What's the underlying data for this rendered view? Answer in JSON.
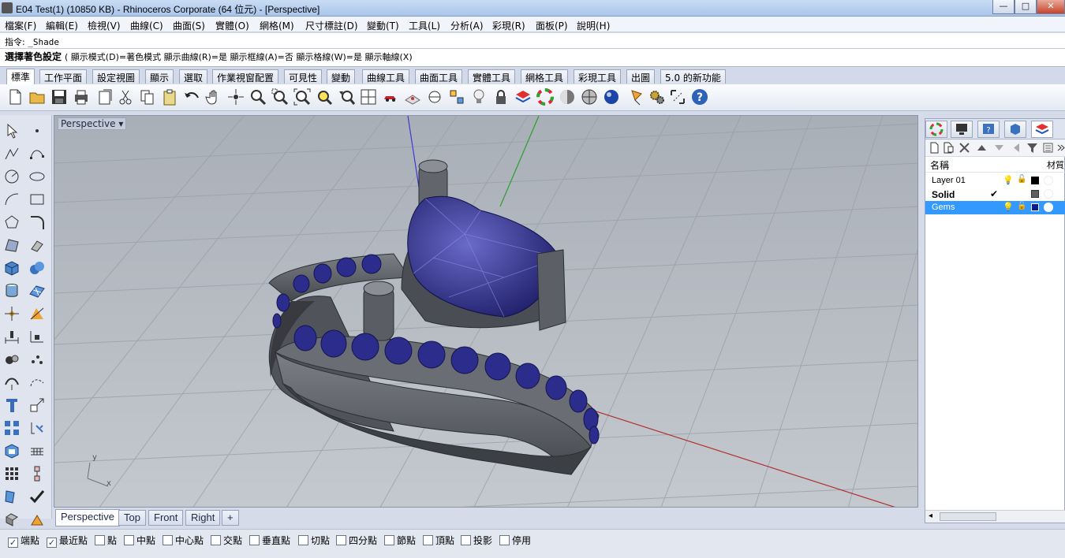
{
  "window": {
    "title": "E04 Test(1) (10850 KB) - Rhinoceros Corporate (64 位元) - [Perspective]",
    "min": "—",
    "max": "□",
    "close": "✕"
  },
  "menu": [
    "檔案(F)",
    "編輯(E)",
    "檢視(V)",
    "曲線(C)",
    "曲面(S)",
    "實體(O)",
    "網格(M)",
    "尺寸標註(D)",
    "變動(T)",
    "工具(L)",
    "分析(A)",
    "彩現(R)",
    "面板(P)",
    "說明(H)"
  ],
  "command": {
    "label": "指令:",
    "value": "_Shade",
    "prompt": "選擇著色設定",
    "options": "( 顯示模式(D)=著色模式  顯示曲線(R)=是  顯示框線(A)=否  顯示格線(W)=是  顯示軸線(X)"
  },
  "tabs": [
    "標準",
    "工作平面",
    "設定視圖",
    "顯示",
    "選取",
    "作業視窗配置",
    "可見性",
    "變動",
    "曲線工具",
    "曲面工具",
    "實體工具",
    "網格工具",
    "彩現工具",
    "出圖",
    "5.0 的新功能"
  ],
  "viewport": {
    "name": "Perspective",
    "dropdown": "▾",
    "axis_x": "x",
    "axis_y": "y"
  },
  "viewport_tabs": [
    "Perspective",
    "Top",
    "Front",
    "Right",
    "+"
  ],
  "snaps": [
    {
      "label": "端點",
      "checked": true
    },
    {
      "label": "最近點",
      "checked": true
    },
    {
      "label": "點",
      "checked": false
    },
    {
      "label": "中點",
      "checked": false
    },
    {
      "label": "中心點",
      "checked": false
    },
    {
      "label": "交點",
      "checked": false
    },
    {
      "label": "垂直點",
      "checked": false
    },
    {
      "label": "切點",
      "checked": false
    },
    {
      "label": "四分點",
      "checked": false
    },
    {
      "label": "節點",
      "checked": false
    },
    {
      "label": "頂點",
      "checked": false
    },
    {
      "label": "投影",
      "checked": false
    },
    {
      "label": "停用",
      "checked": false
    }
  ],
  "check_mark": "✓",
  "layers": {
    "col_name": "名稱",
    "col_material": "材質",
    "rows": [
      {
        "name": "Layer 01",
        "current": "",
        "color": "#000000",
        "selected": false
      },
      {
        "name": "Solid",
        "current": "✔",
        "color": "#606060",
        "selected": false
      },
      {
        "name": "Gems",
        "current": "",
        "color": "#0a1a8c",
        "selected": true
      }
    ]
  },
  "colors": {
    "accent": "#3399ff",
    "gem": "#2a2a88",
    "metal": "#5a5d62"
  }
}
